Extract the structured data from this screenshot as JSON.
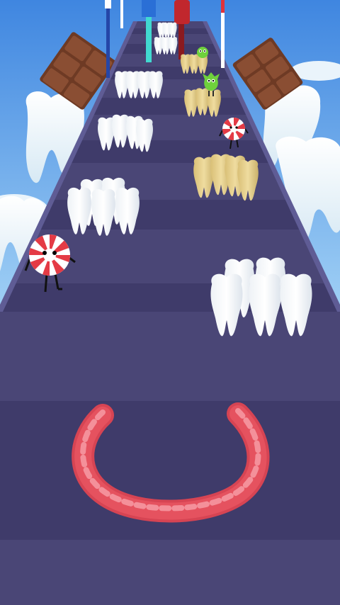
{
  "colors": {
    "sky_top": "#3f86e0",
    "sky_bottom": "#a9d7f7",
    "road_dark": "#3f3b6a",
    "road_light": "#4a4676",
    "road_edge": "#5f5c95",
    "tooth_white": "#ffffff",
    "tooth_shadow": "#dfe6ee",
    "tooth_yellow": "#e6cf8c",
    "tooth_yellow_shadow": "#c9b06a",
    "gum_red": "#e5525f",
    "gum_light": "#f4909a",
    "chocolate": "#8a4e33",
    "peppermint_red": "#e43b45",
    "germ_green": "#6fd13c"
  },
  "scene": {
    "type": "endless-runner",
    "player": "gum-ring",
    "collectibles": [
      "white-teeth-group",
      "yellow-teeth-group"
    ],
    "obstacles": [
      "peppermint-candy-enemy",
      "germ-monster",
      "toothpaste-post"
    ],
    "background_props": [
      "chocolate-bar",
      "giant-molar",
      "cloud"
    ]
  }
}
